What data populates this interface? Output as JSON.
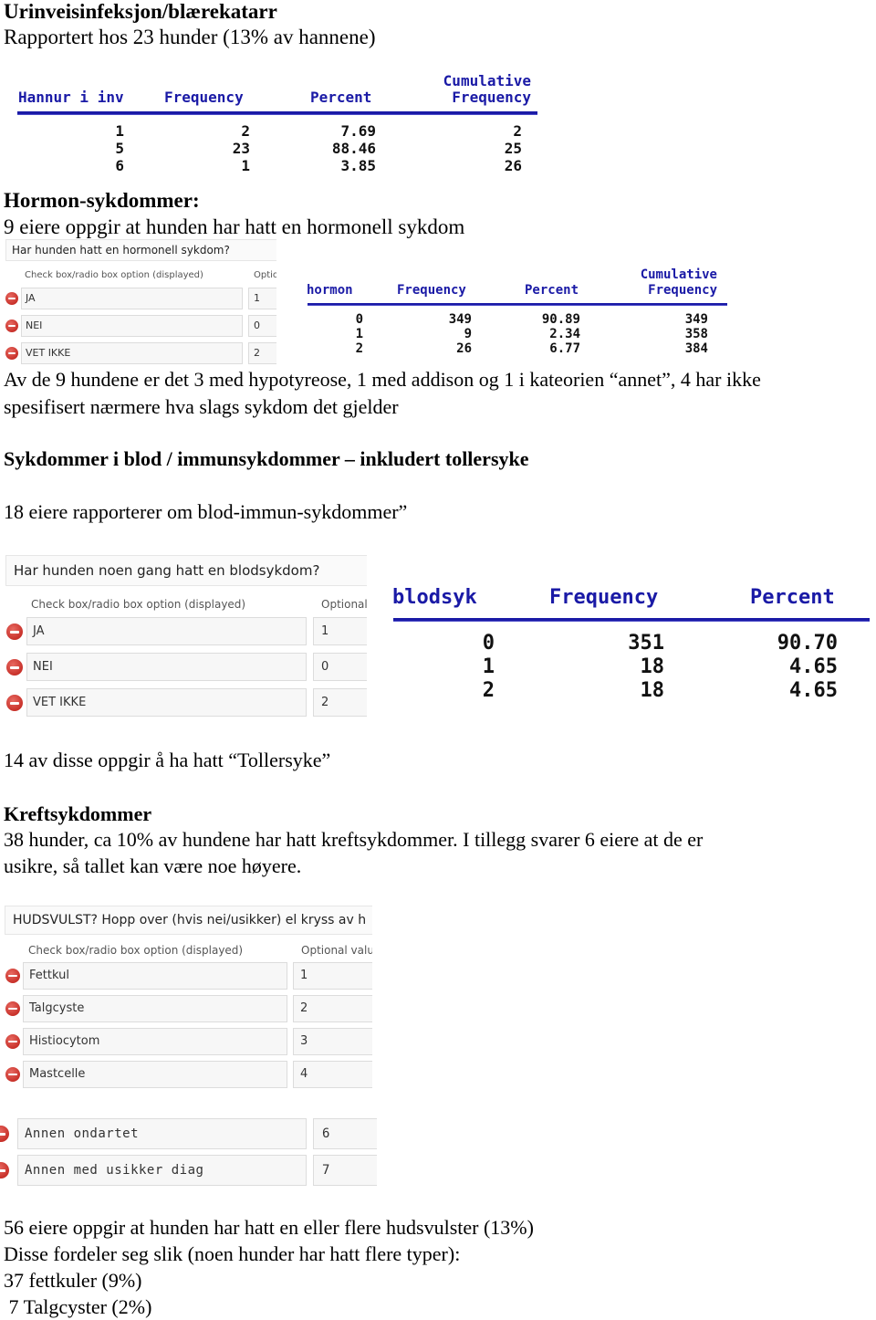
{
  "urinary": {
    "title": "Urinveisinfeksjon/blærekatarr",
    "subtitle": "Rapportert hos 23 hunder (13% av hannene)",
    "table": {
      "headers": [
        "Hannur i inv",
        "Frequency",
        "Percent",
        "Cumulative",
        "Frequency"
      ],
      "rows": [
        {
          "value": "1",
          "frequency": "2",
          "percent": "7.69",
          "cumulative": "2"
        },
        {
          "value": "5",
          "frequency": "23",
          "percent": "88.46",
          "cumulative": "25"
        },
        {
          "value": "6",
          "frequency": "1",
          "percent": "3.85",
          "cumulative": "26"
        }
      ]
    }
  },
  "hormone": {
    "title": "Hormon-sykdommer:",
    "subtitle": "9 eiere oppgir at hunden har hatt en hormonell sykdom",
    "form": {
      "question": "Har hunden hatt en hormonell sykdom?",
      "col_option": "Check box/radio box option (displayed)",
      "col_value": "Optio",
      "options": [
        {
          "label": "JA",
          "value": "1"
        },
        {
          "label": "NEI",
          "value": "0"
        },
        {
          "label": "VET IKKE",
          "value": "2"
        }
      ]
    },
    "table": {
      "headers": [
        "hormon",
        "Frequency",
        "Percent",
        "Cumulative",
        "Frequency"
      ],
      "rows": [
        {
          "value": "0",
          "frequency": "349",
          "percent": "90.89",
          "cumulative": "349"
        },
        {
          "value": "1",
          "frequency": "9",
          "percent": "2.34",
          "cumulative": "358"
        },
        {
          "value": "2",
          "frequency": "26",
          "percent": "6.77",
          "cumulative": "384"
        }
      ]
    },
    "detail_line1": "Av de 9 hundene er det 3 med hypotyreose, 1 med addison og 1 i kateorien “annet”, 4 har ikke",
    "detail_line2": "spesifisert nærmere hva slags sykdom det gjelder"
  },
  "blood": {
    "title": "Sykdommer i blod / immunsykdommer – inkludert tollersyke",
    "subtitle": "18 eiere rapporterer om blod-immun-sykdommer”",
    "form": {
      "question": "Har hunden noen gang hatt en blodsykdom?",
      "col_option": "Check box/radio box option (displayed)",
      "col_value": "Optional",
      "options": [
        {
          "label": "JA",
          "value": "1"
        },
        {
          "label": "NEI",
          "value": "0"
        },
        {
          "label": "VET IKKE",
          "value": "2"
        }
      ]
    },
    "table": {
      "headers": [
        "blodsyk",
        "Frequency",
        "Percent"
      ],
      "rows": [
        {
          "value": "0",
          "frequency": "351",
          "percent": "90.70"
        },
        {
          "value": "1",
          "frequency": "18",
          "percent": "4.65"
        },
        {
          "value": "2",
          "frequency": "18",
          "percent": "4.65"
        }
      ]
    },
    "toller_note": "14 av disse oppgir å ha hatt “Tollersyke”"
  },
  "cancer": {
    "title": "Kreftsykdommer",
    "line1": "38 hunder, ca 10% av hundene har hatt kreftsykdommer. I tillegg svarer 6 eiere at de er",
    "line2": "usikre, så tallet kan være noe høyere.",
    "form": {
      "question": "HUDSVULST? Hopp over (hvis nei/usikker) el kryss av h",
      "col_option": "Check box/radio box option (displayed)",
      "col_value": "Optional value",
      "options": [
        {
          "label": "Fettkul",
          "value": "1"
        },
        {
          "label": "Talgcyste",
          "value": "2"
        },
        {
          "label": "Histiocytom",
          "value": "3"
        },
        {
          "label": "Mastcelle",
          "value": "4"
        }
      ],
      "options_more": [
        {
          "label": "Annen ondartet",
          "value": "6"
        },
        {
          "label": "Annen med usikker diag",
          "value": "7"
        }
      ]
    },
    "summary": [
      "56 eiere oppgir at hunden har hatt en eller flere hudsvulster (13%)",
      "Disse fordeler seg slik (noen hunder har hatt flere typer):",
      "37 fettkuler (9%)",
      " 7 Talgcyster (2%)"
    ]
  }
}
